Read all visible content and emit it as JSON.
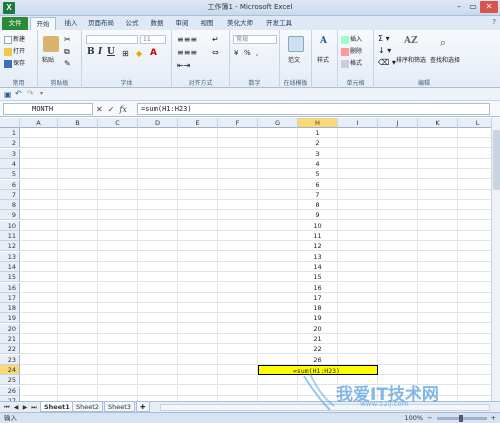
{
  "window": {
    "title": "工作簿1 - Microsoft Excel",
    "minimize": "–",
    "restore": "▭",
    "close": "✕"
  },
  "tabs": [
    {
      "label": "文件"
    },
    {
      "label": "开始"
    },
    {
      "label": "插入"
    },
    {
      "label": "页面布局"
    },
    {
      "label": "公式"
    },
    {
      "label": "数据"
    },
    {
      "label": "审阅"
    },
    {
      "label": "视图"
    },
    {
      "label": "美化大师"
    },
    {
      "label": "开发工具"
    }
  ],
  "ribbon": {
    "common": {
      "new": "新建",
      "open": "打开",
      "save": "保存",
      "label": "常用"
    },
    "clipboard": {
      "paste": "粘贴",
      "label": "剪贴板"
    },
    "font": {
      "size": "11",
      "label": "字体"
    },
    "alignment": {
      "label": "对齐方式"
    },
    "number": {
      "format": "常规",
      "percent": "%",
      "label": "数字"
    },
    "online": {
      "template": "范文",
      "label": "在线模板"
    },
    "styles": {
      "style": "样式"
    },
    "cells": {
      "insert": "插入",
      "delete": "删除",
      "format": "格式",
      "label": "单元格"
    },
    "editing": {
      "sort": "排序和筛选",
      "find": "查找和选择",
      "label": "编辑"
    }
  },
  "namebox": "MONTH",
  "formula": "=sum(H1:H23)",
  "columns": [
    "A",
    "B",
    "C",
    "D",
    "E",
    "F",
    "G",
    "H",
    "I",
    "J",
    "K",
    "L"
  ],
  "rows": [
    "1",
    "2",
    "3",
    "4",
    "5",
    "6",
    "7",
    "8",
    "9",
    "10",
    "11",
    "12",
    "13",
    "14",
    "15",
    "16",
    "17",
    "18",
    "19",
    "20",
    "21",
    "22",
    "23",
    "24",
    "25",
    "26",
    "27"
  ],
  "h_values": [
    "1",
    "2",
    "3",
    "4",
    "5",
    "6",
    "7",
    "8",
    "9",
    "10",
    "11",
    "12",
    "13",
    "14",
    "15",
    "16",
    "17",
    "18",
    "19",
    "20",
    "21",
    "22",
    "26"
  ],
  "formula_cell_text": "=sum(H1:H23)",
  "sheets": [
    "Sheet1",
    "Sheet2",
    "Sheet3"
  ],
  "status": {
    "mode": "输入",
    "zoom": "100%"
  },
  "watermark": {
    "text": "我爱IT技术网",
    "url": "www.52ij.com"
  }
}
